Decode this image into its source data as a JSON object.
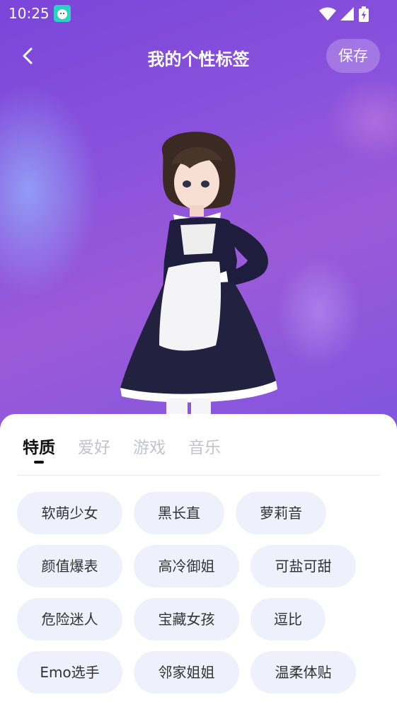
{
  "status_bar": {
    "time": "10:25"
  },
  "header": {
    "title": "我的个性标签",
    "save_label": "保存"
  },
  "tabs": [
    {
      "label": "特质",
      "active": true
    },
    {
      "label": "爱好",
      "active": false
    },
    {
      "label": "游戏",
      "active": false
    },
    {
      "label": "音乐",
      "active": false
    }
  ],
  "tags": [
    {
      "label": "软萌少女"
    },
    {
      "label": "黑长直"
    },
    {
      "label": "萝莉音"
    },
    {
      "label": "颜值爆表"
    },
    {
      "label": "高冷御姐"
    },
    {
      "label": "可盐可甜"
    },
    {
      "label": "危险迷人"
    },
    {
      "label": "宝藏女孩"
    },
    {
      "label": "逗比"
    },
    {
      "label": "Emo选手"
    },
    {
      "label": "邻家姐姐"
    },
    {
      "label": "温柔体贴"
    }
  ],
  "colors": {
    "hero_bg": "#7a45d9",
    "tag_bg": "#eef0fb",
    "tab_active": "#111111",
    "tab_inactive": "#c3c3cc"
  },
  "icons": {
    "back": "chevron-left-icon",
    "wifi": "wifi-icon",
    "signal": "signal-icon",
    "battery": "battery-icon",
    "app": "app-notification-icon"
  }
}
